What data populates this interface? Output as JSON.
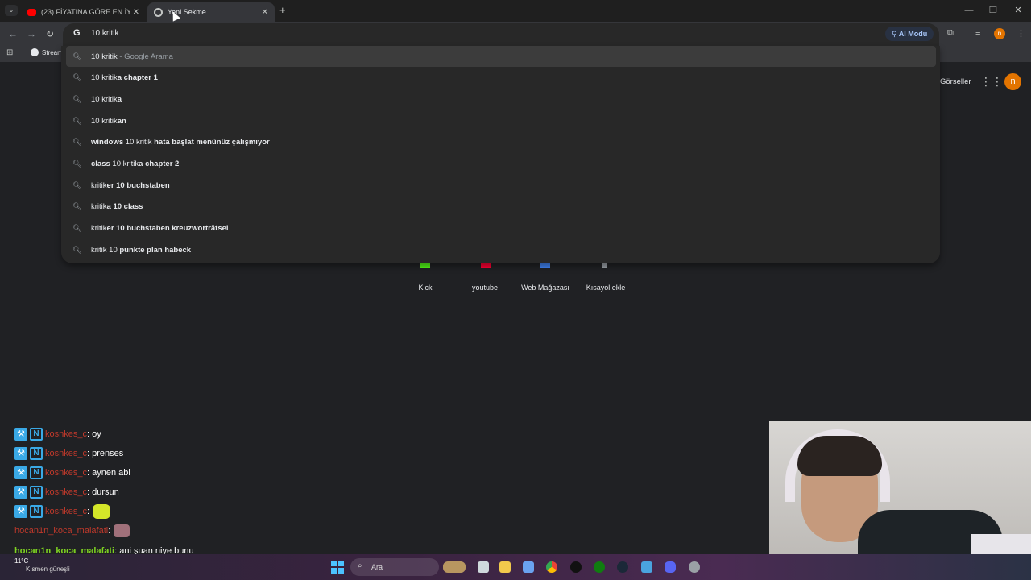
{
  "tabs": [
    {
      "title": "(23) FİYATINA GÖRE EN İYİSİ / P",
      "icon": "youtube-icon"
    },
    {
      "title": "Yeni Sekme",
      "icon": "chrome-icon"
    }
  ],
  "omnibox": {
    "value": "10 kritik",
    "ai_mode_label": "AI Modu",
    "avatar_letter": "n"
  },
  "bookmarks": {
    "first": "Stream"
  },
  "suggestions": [
    {
      "pre": "10 kritik",
      "bold": "",
      "post": "",
      "suffix": " - Google Arama"
    },
    {
      "pre": "10 kritik",
      "bold": "a chapter 1",
      "post": "",
      "suffix": ""
    },
    {
      "pre": "10 kritik",
      "bold": "a",
      "post": "",
      "suffix": ""
    },
    {
      "pre": "10 kritik",
      "bold": "an",
      "post": "",
      "suffix": ""
    },
    {
      "pre": "",
      "bold": "windows ",
      "post": "10 kritik",
      "suffix": " hata başlat menünüz çalışmıyor"
    },
    {
      "pre": "",
      "bold": "class ",
      "post": "10 kritik",
      "suffix": "a chapter 2"
    },
    {
      "pre": "kritik",
      "bold": "er 10 buchstaben",
      "post": "",
      "suffix": ""
    },
    {
      "pre": "kritik",
      "bold": "a ",
      "post": "10 class",
      "suffix": ""
    },
    {
      "pre": "kritik",
      "bold": "er 10 buchstaben kreuzworträtsel",
      "post": "",
      "suffix": ""
    },
    {
      "pre": "kritik 10 ",
      "bold": "punkte plan habeck",
      "post": "",
      "suffix": ""
    }
  ],
  "page": {
    "images_link": "Görseller",
    "avatar_letter": "n",
    "shortcuts": [
      "Kick",
      "youtube",
      "Web Mağazası",
      "Kısayol ekle"
    ]
  },
  "chat": [
    {
      "user": "kosnkes_c",
      "msg": ": oy"
    },
    {
      "user": "kosnkes_c",
      "msg": ": prenses"
    },
    {
      "user": "kosnkes_c",
      "msg": ": aynen abi"
    },
    {
      "user": "kosnkes_c",
      "msg": ": dursun"
    },
    {
      "user": "kosnkes_c",
      "msg": ":"
    },
    {
      "user": "hocan1n_koca_malafati",
      "msg": ":"
    },
    {
      "user": "hocan1n_koca_malafati",
      "msg": ": ani şuan niye bunu"
    }
  ],
  "taskbar": {
    "search_label": "Ara",
    "weather_temp": "11°C",
    "weather_label": "Kısmen güneşli"
  },
  "colors": {
    "tabstrip": "#1f1f1f",
    "toolbar": "#35363a",
    "dropdown": "#282828",
    "page_bg": "#202124",
    "accent_avatar": "#e37400",
    "chat_badge": "#3aa9e6"
  }
}
